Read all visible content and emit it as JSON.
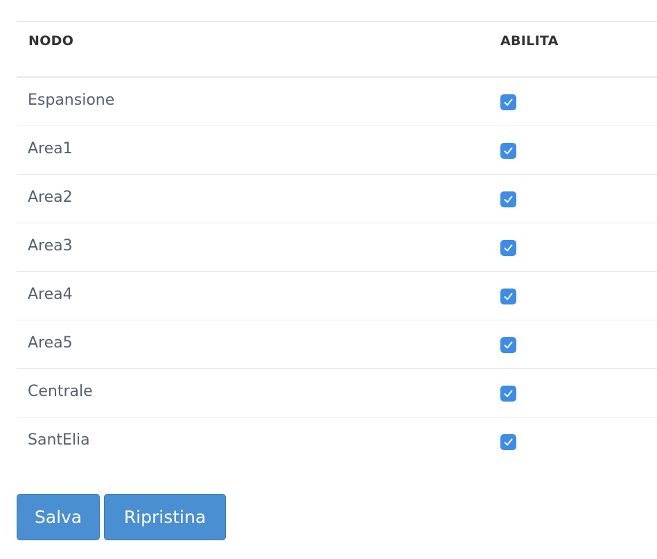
{
  "table": {
    "headers": {
      "node": "NODO",
      "enable": "ABILITA"
    },
    "rows": [
      {
        "name": "Espansione",
        "enabled": true
      },
      {
        "name": "Area1",
        "enabled": true
      },
      {
        "name": "Area2",
        "enabled": true
      },
      {
        "name": "Area3",
        "enabled": true
      },
      {
        "name": "Area4",
        "enabled": true
      },
      {
        "name": "Area5",
        "enabled": true
      },
      {
        "name": "Centrale",
        "enabled": true
      },
      {
        "name": "SantElia",
        "enabled": true
      }
    ]
  },
  "actions": {
    "save_label": "Salva",
    "reset_label": "Ripristina"
  },
  "icons": {
    "checkbox": "check-icon"
  },
  "colors": {
    "checkbox_accent": "#3d8ce6",
    "button_bg": "#4a8fd1",
    "border": "#e5eaf0"
  }
}
